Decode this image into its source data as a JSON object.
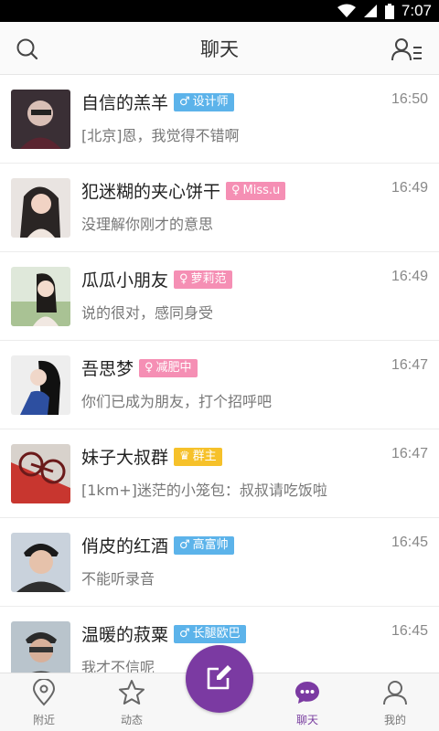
{
  "status_bar": {
    "time": "7:07",
    "icons": [
      "wifi-icon",
      "signal-icon",
      "battery-icon"
    ]
  },
  "header": {
    "title": "聊天",
    "left_icon": "search-icon",
    "right_icon": "contacts-icon"
  },
  "colors": {
    "accent": "#7b3aa2",
    "male_badge": "#5cb3ea",
    "female_badge": "#f58fb4",
    "owner_badge": "#f6c12a"
  },
  "chats": [
    {
      "name": "自信的羔羊",
      "badge": {
        "type": "male",
        "symbol": "♂",
        "text": "设计师"
      },
      "time": "16:50",
      "message": "[北京]恩，我觉得不错啊"
    },
    {
      "name": "犯迷糊的夹心饼干",
      "badge": {
        "type": "female",
        "symbol": "♀",
        "text": "Miss.u"
      },
      "time": "16:49",
      "message": "没理解你刚才的意思"
    },
    {
      "name": "瓜瓜小朋友",
      "badge": {
        "type": "female",
        "symbol": "♀",
        "text": "萝莉范"
      },
      "time": "16:49",
      "message": "说的很对，感同身受"
    },
    {
      "name": "吾思梦",
      "badge": {
        "type": "female",
        "symbol": "♀",
        "text": "减肥中"
      },
      "time": "16:47",
      "message": "你们已成为朋友，打个招呼吧"
    },
    {
      "name": "妹子大叔群",
      "badge": {
        "type": "owner",
        "symbol": "♛",
        "text": "群主"
      },
      "time": "16:47",
      "message": "[1km+]迷茫的小笼包：叔叔请吃饭啦"
    },
    {
      "name": "俏皮的红酒",
      "badge": {
        "type": "male",
        "symbol": "♂",
        "text": "高富帅"
      },
      "time": "16:45",
      "message": "不能听录音"
    },
    {
      "name": "温暖的菽粟",
      "badge": {
        "type": "male",
        "symbol": "♂",
        "text": "长腿欧巴"
      },
      "time": "16:45",
      "message": "我才不信呢"
    }
  ],
  "tabs": [
    {
      "label": "附近",
      "icon": "location-icon",
      "active": false
    },
    {
      "label": "动态",
      "icon": "star-icon",
      "active": false
    },
    {
      "label": "聊天",
      "icon": "chat-bubble-icon",
      "active": true
    },
    {
      "label": "我的",
      "icon": "user-icon",
      "active": false
    }
  ],
  "compose_icon": "compose-icon"
}
